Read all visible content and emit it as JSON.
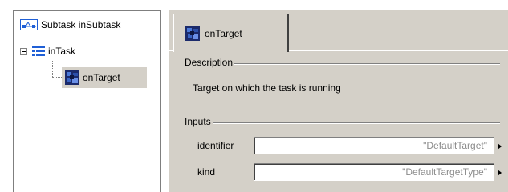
{
  "tree": {
    "root_label": "Subtask inSubtask",
    "child_label": "inTask",
    "grandchild_label": "onTarget",
    "icons": [
      "subtask-icon",
      "task-icon",
      "target-icon"
    ]
  },
  "editor": {
    "tab_label": "onTarget",
    "description_header": "Description",
    "description_text": "Target on which the task is running",
    "inputs_header": "Inputs",
    "fields": [
      {
        "label": "identifier",
        "value": "\"DefaultTarget\""
      },
      {
        "label": "kind",
        "value": "\"DefaultTargetType\""
      }
    ]
  },
  "colors": {
    "panel": "#d4d0c8",
    "selection": "#d4d0c8",
    "placeholder_text": "#8c8c8c",
    "tree_blue": "#1f5fd6"
  }
}
